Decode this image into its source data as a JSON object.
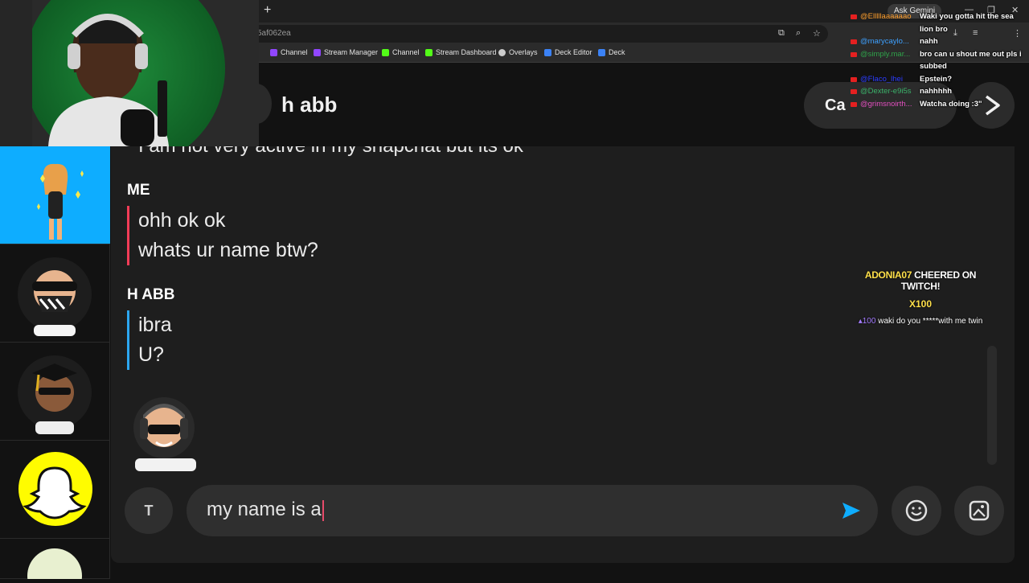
{
  "browser": {
    "url_fragment": "5af062ea",
    "ask_gemini": "Ask Gemini",
    "new_tab": "+",
    "bookmarks": [
      {
        "label": "Channel",
        "color": "#9146ff"
      },
      {
        "label": "Stream Manager",
        "color": "#9146ff"
      },
      {
        "label": "Channel",
        "color": "#53fc18"
      },
      {
        "label": "Stream Dashboard",
        "color": "#53fc18"
      },
      {
        "label": "Overlays",
        "color": "#cccccc"
      },
      {
        "label": "Deck Editor",
        "color": "#3b82f6"
      },
      {
        "label": "Deck",
        "color": "#3b82f6"
      }
    ]
  },
  "chat_header": {
    "name": "h abb",
    "call_label": "Ca"
  },
  "conversation": {
    "cut_message": "I am not very active in my snapchat but its ok",
    "groups": [
      {
        "sender": "ME",
        "color": "#f23c57",
        "lines": [
          "ohh ok ok",
          "whats ur name btw?"
        ]
      },
      {
        "sender": "H ABB",
        "color": "#2ca6f0",
        "lines": [
          "ibra",
          "U?"
        ]
      }
    ]
  },
  "composer": {
    "text_format_label": "T",
    "draft": "my name is a"
  },
  "stream_chat": [
    {
      "user": "@Elllllaaaaaao",
      "user_color": "#ff9f2d",
      "message": "Waki you gotta hit the sea"
    },
    {
      "user": "",
      "user_color": "#ffffff",
      "message": "lion bro"
    },
    {
      "user": "@marycaylo...",
      "user_color": "#3da0ff",
      "message": "nahh"
    },
    {
      "user": "@simply.mar...",
      "user_color": "#2fa34a",
      "message": "bro can u shout me out pls i"
    },
    {
      "user": "",
      "user_color": "#ffffff",
      "message": "subbed"
    },
    {
      "user": "@Flaco_lhei",
      "user_color": "#2b3cff",
      "message": "Epstein?"
    },
    {
      "user": "@Dexter-e9i5s",
      "user_color": "#3bb36a",
      "message": "nahhhhh"
    },
    {
      "user": "@grimsnoirth...",
      "user_color": "#e24fbf",
      "message": "Watcha doing :3\""
    }
  ],
  "cheer_alert": {
    "user": "ADONIA07",
    "title_rest": " CHEERED ON TWITCH!",
    "amount": "X100",
    "bits": "100",
    "message": "waki do you *****with me twin"
  },
  "colors": {
    "snapchat_yellow": "#fffc00",
    "active_chat_blue": "#0eadff",
    "send_blue": "#0eadff"
  }
}
